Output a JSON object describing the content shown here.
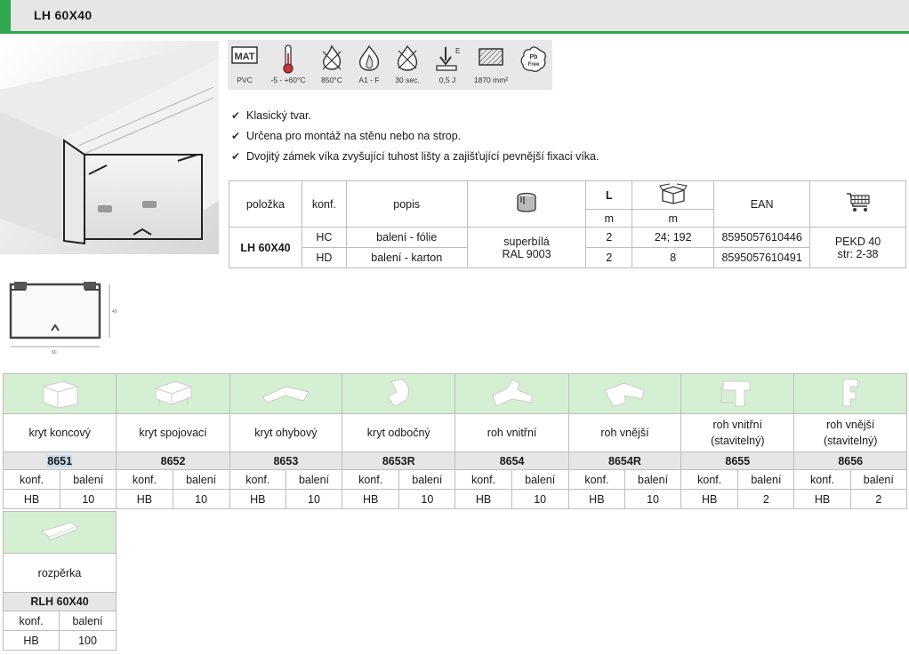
{
  "header": {
    "title": "LH 60X40",
    "accent_color": "#2fa84f"
  },
  "properties": [
    {
      "icon": "mat-icon",
      "badge": "MAT",
      "label": "PVC"
    },
    {
      "icon": "thermometer-icon",
      "label": "-5 - +60°C"
    },
    {
      "icon": "flame-icon",
      "label": "850°C"
    },
    {
      "icon": "fire-class-icon",
      "label": "A1 - F"
    },
    {
      "icon": "fire-time-icon",
      "label": "30 sec."
    },
    {
      "icon": "impact-icon",
      "badge": "E",
      "label": "0,5 J"
    },
    {
      "icon": "cross-section-icon",
      "label": "1870 mm²"
    },
    {
      "icon": "pb-free-icon",
      "badge_line1": "Pb",
      "badge_line2": "Free",
      "label": ""
    }
  ],
  "bullets": [
    "Klasický tvar.",
    "Určena pro montáž na stěnu nebo na strop.",
    "Dvojitý zámek víka zvyšující tuhost lišty a zajišťující pevnější fixaci víka."
  ],
  "main_table": {
    "headers": {
      "item": "položka",
      "conf": "konf.",
      "desc": "popis",
      "length": "L",
      "length_unit": "m",
      "package_unit": "m",
      "ean": "EAN"
    },
    "product": "LH 60X40",
    "color": [
      "superbílá",
      "RAL 9003"
    ],
    "catalog": [
      "PEKD 40",
      "str: 2-38"
    ],
    "rows": [
      {
        "conf": "HC",
        "desc": "balení - fólie",
        "length": "2",
        "package": "24; 192",
        "ean": "8595057610446"
      },
      {
        "conf": "HD",
        "desc": "balení - karton",
        "length": "2",
        "package": "8",
        "ean": "8595057610491"
      }
    ]
  },
  "accessories": {
    "conf_label": "konf.",
    "pack_label": "balení",
    "items": [
      {
        "name": [
          "kryt koncový"
        ],
        "code": "8651",
        "conf": "HB",
        "pack": "10",
        "icon": "end-cap-icon"
      },
      {
        "name": [
          "kryt spojovací"
        ],
        "code": "8652",
        "conf": "HB",
        "pack": "10",
        "icon": "joint-cover-icon"
      },
      {
        "name": [
          "kryt ohybový"
        ],
        "code": "8653",
        "conf": "HB",
        "pack": "10",
        "icon": "flat-angle-icon"
      },
      {
        "name": [
          "kryt odbočný"
        ],
        "code": "8653R",
        "conf": "HB",
        "pack": "10",
        "icon": "tee-icon"
      },
      {
        "name": [
          "roh vnitřní"
        ],
        "code": "8654",
        "conf": "HB",
        "pack": "10",
        "icon": "internal-corner-icon"
      },
      {
        "name": [
          "roh vnější"
        ],
        "code": "8654R",
        "conf": "HB",
        "pack": "10",
        "icon": "external-corner-icon"
      },
      {
        "name": [
          "roh vnitřní",
          "(stavitelný)"
        ],
        "code": "8655",
        "conf": "HB",
        "pack": "2",
        "icon": "adjustable-internal-corner-icon"
      },
      {
        "name": [
          "roh vnější",
          "(stavitelný)"
        ],
        "code": "8656",
        "conf": "HB",
        "pack": "2",
        "icon": "adjustable-external-corner-icon"
      }
    ],
    "spacer": {
      "name": "rozpěrka",
      "code": "RLH 60X40",
      "conf": "HB",
      "pack": "100",
      "icon": "spacer-icon"
    }
  }
}
